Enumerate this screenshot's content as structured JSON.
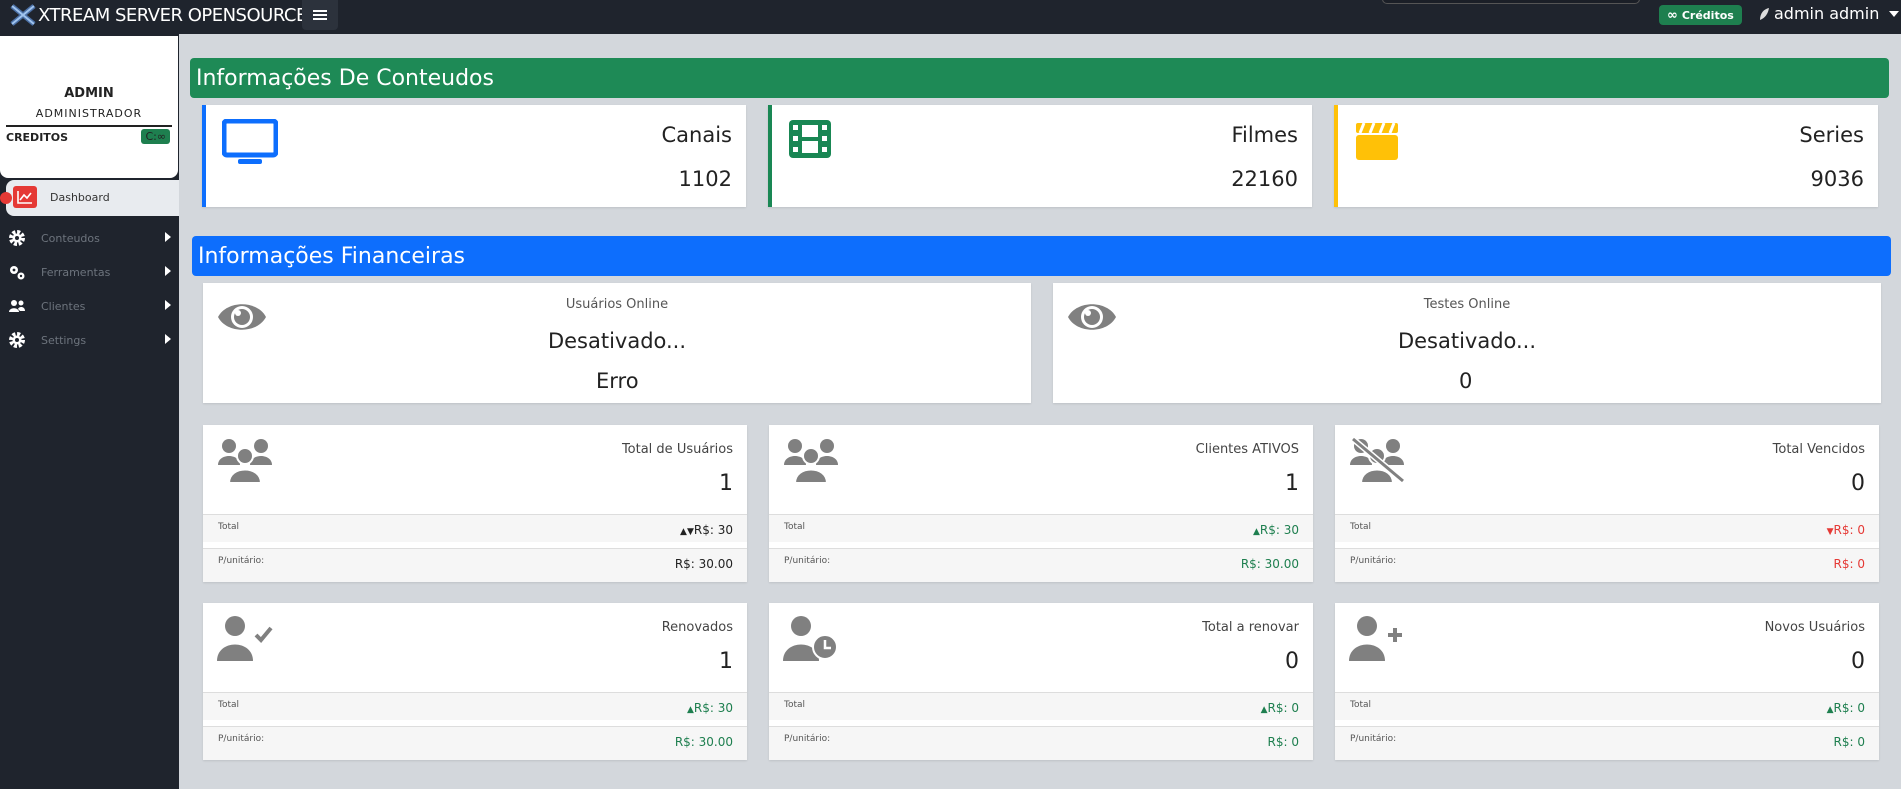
{
  "header": {
    "brand": "XTREAM SERVER OPENSOURCE",
    "creditos_label": "Créditos",
    "user_label": "admin admin"
  },
  "sidebar": {
    "profile_name": "ADMIN",
    "profile_role": "ADMINISTRADOR",
    "credits_label": "CREDITOS",
    "credits_value": "C:∞",
    "items": [
      {
        "label": "Dashboard"
      },
      {
        "label": "Conteudos"
      },
      {
        "label": "Ferramentas"
      },
      {
        "label": "Clientes"
      },
      {
        "label": "Settings"
      }
    ]
  },
  "content_section": {
    "title": "Informações De Conteudos",
    "cards": [
      {
        "title": "Canais",
        "value": "1102",
        "icon": "tv-icon",
        "color": "#0d6efd"
      },
      {
        "title": "Filmes",
        "value": "22160",
        "icon": "film-icon",
        "color": "#198754"
      },
      {
        "title": "Series",
        "value": "9036",
        "icon": "clapperboard-icon",
        "color": "#ffc107"
      }
    ]
  },
  "finance_section": {
    "title": "Informações Financeiras",
    "online": [
      {
        "label": "Usuários Online",
        "status": "Desativado...",
        "sub": "Erro"
      },
      {
        "label": "Testes Online",
        "status": "Desativado...",
        "sub": "0"
      }
    ],
    "metrics": [
      {
        "title": "Total de Usuários",
        "value": "1",
        "total_label": "Total",
        "total_value": "R$: 30",
        "unit_label": "P/unitário:",
        "unit_value": "R$: 30.00",
        "tone": "black",
        "trend": "updown"
      },
      {
        "title": "Clientes ATIVOS",
        "value": "1",
        "total_label": "Total",
        "total_value": "R$: 30",
        "unit_label": "P/unitário:",
        "unit_value": "R$: 30.00",
        "tone": "green",
        "trend": "up"
      },
      {
        "title": "Total Vencidos",
        "value": "0",
        "total_label": "Total",
        "total_value": "R$: 0",
        "unit_label": "P/unitário:",
        "unit_value": "R$: 0",
        "tone": "red",
        "trend": "down"
      },
      {
        "title": "Renovados",
        "value": "1",
        "total_label": "Total",
        "total_value": "R$: 30",
        "unit_label": "P/unitário:",
        "unit_value": "R$: 30.00",
        "tone": "green",
        "trend": "up"
      },
      {
        "title": "Total a renovar",
        "value": "0",
        "total_label": "Total",
        "total_value": "R$: 0",
        "unit_label": "P/unitário:",
        "unit_value": "R$: 0",
        "tone": "green",
        "trend": "up"
      },
      {
        "title": "Novos Usuários",
        "value": "0",
        "total_label": "Total",
        "total_value": "R$: 0",
        "unit_label": "P/unitário:",
        "unit_value": "R$: 0",
        "tone": "green",
        "trend": "up"
      }
    ]
  },
  "colors": {
    "green": "#1e8a56",
    "blue": "#0d6efd",
    "red": "#e53935"
  }
}
